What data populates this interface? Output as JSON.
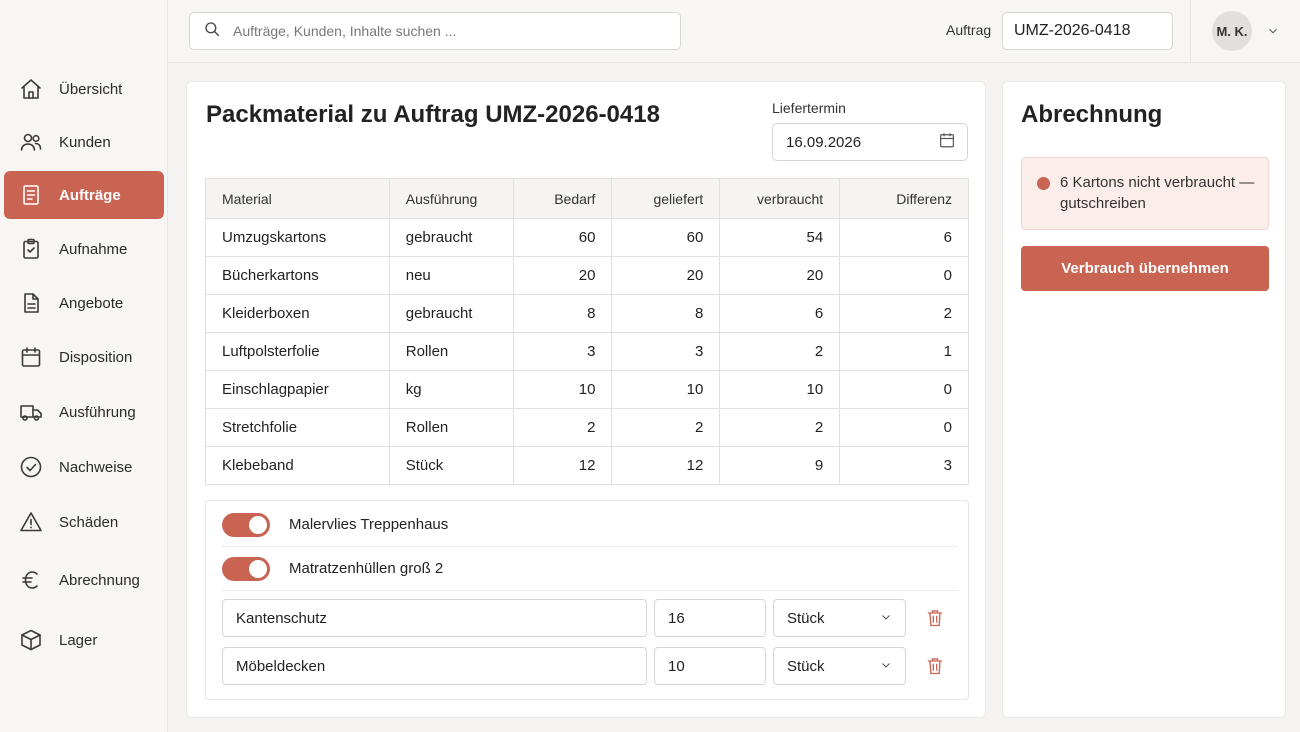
{
  "sidebar": {
    "items": [
      {
        "label": "Übersicht",
        "icon": "home-icon"
      },
      {
        "label": "Kunden",
        "icon": "users-icon"
      },
      {
        "label": "Aufträge",
        "icon": "document-icon"
      },
      {
        "label": "Aufnahme",
        "icon": "clipboard-icon"
      },
      {
        "label": "Angebote",
        "icon": "file-icon"
      },
      {
        "label": "Disposition",
        "icon": "calendar-icon"
      },
      {
        "label": "Ausführung",
        "icon": "truck-icon"
      },
      {
        "label": "Nachweise",
        "icon": "check-circle-icon"
      },
      {
        "label": "Schäden",
        "icon": "warning-icon"
      },
      {
        "label": "Abrechnung",
        "icon": "euro-icon"
      },
      {
        "label": "Lager",
        "icon": "box-icon"
      }
    ],
    "active_index": 2
  },
  "topbar": {
    "search_placeholder": "Aufträge, Kunden, Inhalte suchen ...",
    "auftrag_label": "Auftrag",
    "auftrag_value": "UMZ-2026-0418",
    "user_initials": "M. K."
  },
  "main": {
    "title": "Packmaterial zu Auftrag UMZ-2026-0418",
    "date_label": "Liefertermin",
    "date_value": "16.09.2026",
    "table": {
      "headers": [
        "Material",
        "Ausführung",
        "Bedarf",
        "geliefert",
        "verbraucht",
        "Differenz"
      ],
      "rows": [
        [
          "Umzugskartons",
          "gebraucht",
          "60",
          "60",
          "54",
          "6"
        ],
        [
          "Bücherkartons",
          "neu",
          "20",
          "20",
          "20",
          "0"
        ],
        [
          "Kleiderboxen",
          "gebraucht",
          "8",
          "8",
          "6",
          "2"
        ],
        [
          "Luftpolsterfolie",
          "Rollen",
          "3",
          "3",
          "2",
          "1"
        ],
        [
          "Einschlagpapier",
          "kg",
          "10",
          "10",
          "10",
          "0"
        ],
        [
          "Stretchfolie",
          "Rollen",
          "2",
          "2",
          "2",
          "0"
        ],
        [
          "Klebeband",
          "Stück",
          "12",
          "12",
          "9",
          "3"
        ]
      ]
    },
    "toggles": [
      {
        "label": "Malervlies Treppenhaus",
        "on": true
      },
      {
        "label": "Matratzenhüllen groß 2",
        "on": true
      }
    ],
    "extra_items": [
      {
        "name": "Kantenschutz",
        "qty": "16",
        "unit": "Stück"
      },
      {
        "name": "Möbeldecken",
        "qty": "10",
        "unit": "Stück"
      }
    ]
  },
  "billing": {
    "title": "Abrechnung",
    "notice": "6 Kartons nicht verbraucht — gutschreiben",
    "button": "Verbrauch übernehmen"
  },
  "colors": {
    "accent": "#c96352",
    "notice_bg": "#fbeeea"
  }
}
